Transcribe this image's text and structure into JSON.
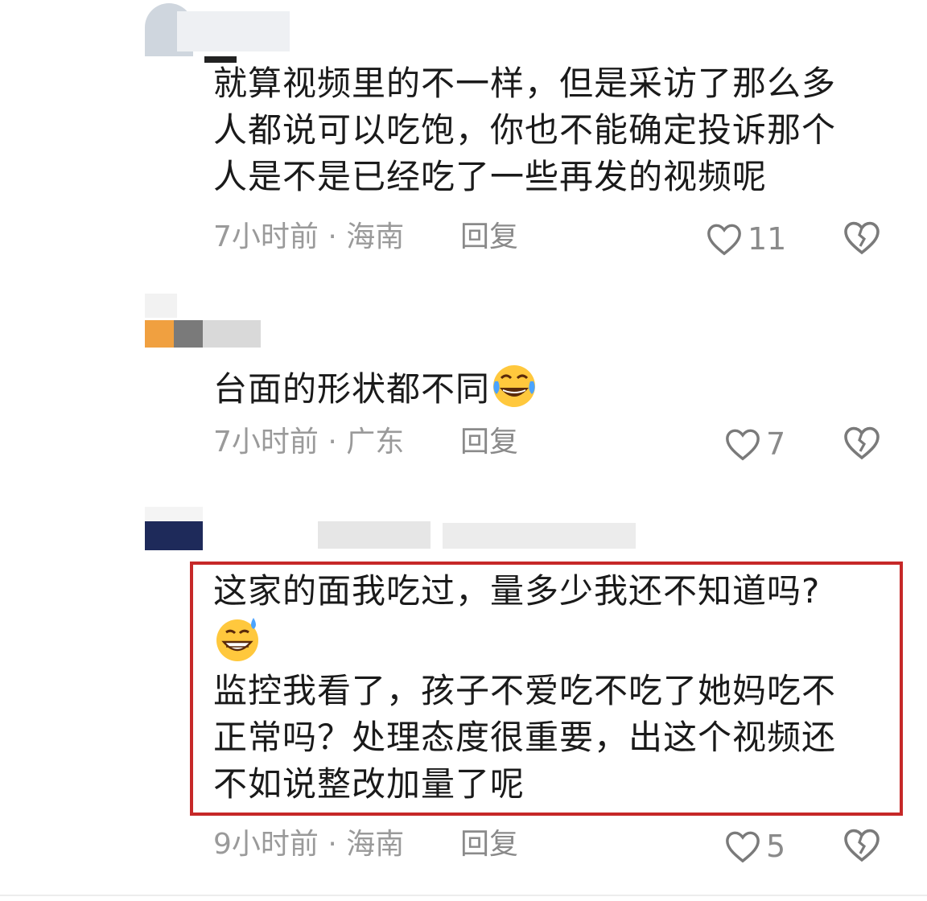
{
  "comments": [
    {
      "text_lines": [
        "就算视频里的不一样，但是采访了那么多",
        "人都说可以吃饱，你也不能确定投诉那个",
        "人是不是已经吃了一些再发的视频呢"
      ],
      "time_location": "7小时前 · 海南",
      "reply_label": "回复",
      "likes": "11"
    },
    {
      "text": "台面的形状都不同",
      "emoji": "rolling-on-floor-laughing",
      "time_location": "7小时前 · 广东",
      "reply_label": "回复",
      "likes": "7"
    },
    {
      "text_line1": "这家的面我吃过，量多少我还不知道吗?",
      "emoji": "grinning-sweat",
      "text_lines2": [
        "监控我看了，孩子不爱吃不吃了她妈吃不",
        "正常吗？处理态度很重要，出这个视频还",
        "不如说整改加量了呢"
      ],
      "time_location": "9小时前 · 海南",
      "reply_label": "回复",
      "likes": "5"
    }
  ],
  "colors": {
    "highlight_border": "#c62828",
    "meta_text": "#9a9a9a",
    "body_text": "#1a1a1a"
  }
}
